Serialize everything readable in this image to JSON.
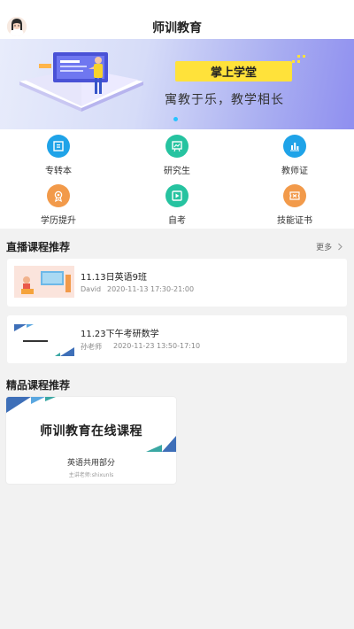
{
  "header": {
    "title": "师训教育"
  },
  "banner": {
    "board_text": "掌上学堂",
    "slogan": "寓教于乐，教学相长"
  },
  "menu": [
    {
      "label": "专转本",
      "icon": "book-icon",
      "color": "#1fa3e8"
    },
    {
      "label": "研究生",
      "icon": "presentation-icon",
      "color": "#26c3a0"
    },
    {
      "label": "教师证",
      "icon": "bar-chart-icon",
      "color": "#1fa3e8"
    },
    {
      "label": "学历提升",
      "icon": "award-icon",
      "color": "#f29a4a"
    },
    {
      "label": "自考",
      "icon": "play-icon",
      "color": "#26c3a0"
    },
    {
      "label": "技能证书",
      "icon": "certificate-icon",
      "color": "#f29a4a"
    }
  ],
  "live": {
    "title": "直播课程推荐",
    "more": "更多",
    "courses": [
      {
        "name": "11.13日英语9班",
        "teacher": "David",
        "time": "2020-11-13 17:30-21:00"
      },
      {
        "name": "11.23下午考研数学",
        "teacher": "孙老师",
        "time": "2020-11-23 13:50-17:10"
      }
    ]
  },
  "featured": {
    "title": "精品课程推荐",
    "card": {
      "title": "师训教育在线课程",
      "subtitle": "英语共用部分",
      "teacher": "主讲老师:shixunls"
    }
  }
}
